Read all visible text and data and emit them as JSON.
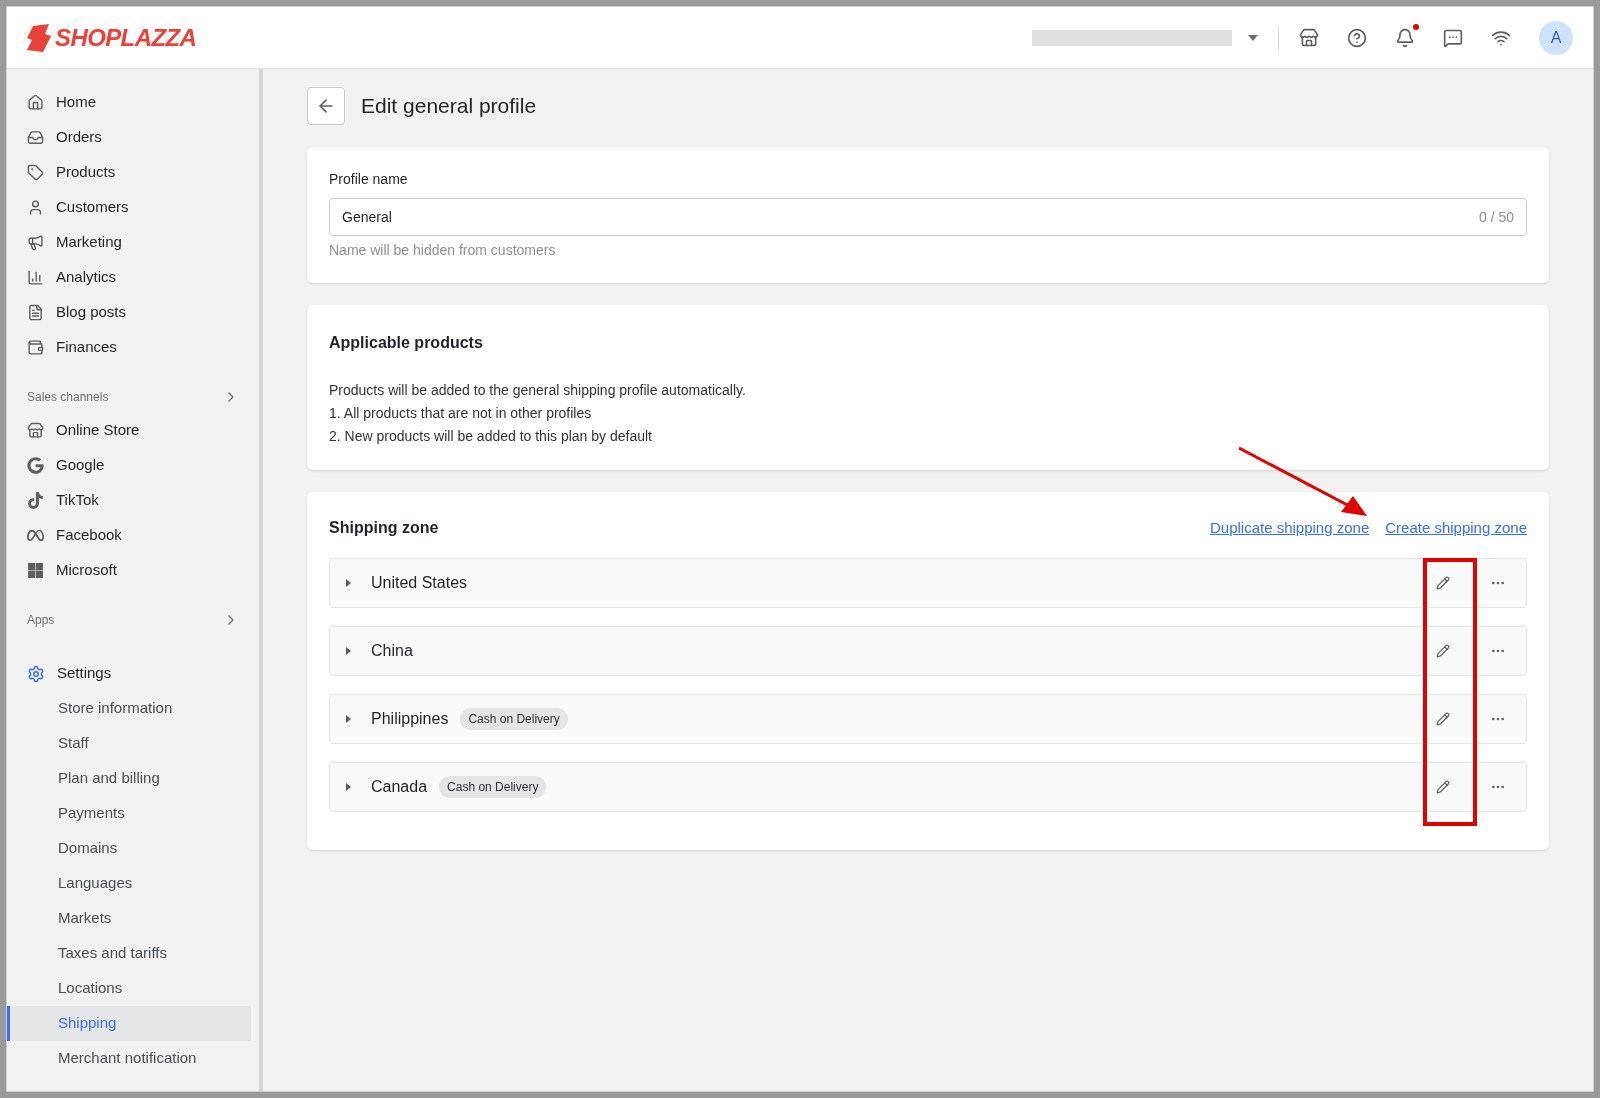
{
  "topbar": {
    "logo": "SHOPLAZZA",
    "avatar": "A",
    "notification_dot": true
  },
  "sidebar": {
    "items": [
      {
        "label": "Home"
      },
      {
        "label": "Orders"
      },
      {
        "label": "Products"
      },
      {
        "label": "Customers"
      },
      {
        "label": "Marketing"
      },
      {
        "label": "Analytics"
      },
      {
        "label": "Blog posts"
      },
      {
        "label": "Finances"
      }
    ],
    "sections": [
      {
        "title": "Sales channels",
        "items": [
          {
            "label": "Online Store"
          },
          {
            "label": "Google"
          },
          {
            "label": "TikTok"
          },
          {
            "label": "Facebook"
          },
          {
            "label": "Microsoft"
          }
        ]
      },
      {
        "title": "Apps"
      }
    ],
    "settings": {
      "label": "Settings",
      "children": [
        {
          "label": "Store information",
          "selected": false
        },
        {
          "label": "Staff",
          "selected": false
        },
        {
          "label": "Plan and billing",
          "selected": false
        },
        {
          "label": "Payments",
          "selected": false
        },
        {
          "label": "Domains",
          "selected": false
        },
        {
          "label": "Languages",
          "selected": false
        },
        {
          "label": "Markets",
          "selected": false
        },
        {
          "label": "Taxes and tariffs",
          "selected": false
        },
        {
          "label": "Locations",
          "selected": false
        },
        {
          "label": "Shipping",
          "selected": true
        },
        {
          "label": "Merchant notification",
          "selected": false
        }
      ]
    }
  },
  "page": {
    "title": "Edit general profile"
  },
  "profile": {
    "label": "Profile name",
    "value": "General",
    "counter": "0 / 50",
    "help": "Name will be hidden from customers"
  },
  "applicable": {
    "title": "Applicable products",
    "lines": [
      "Products will be added to the general shipping profile automatically.",
      "1. All products that are not in other profiles",
      "2. New products will be added to this plan by default"
    ]
  },
  "shipping": {
    "title": "Shipping zone",
    "links": [
      "Duplicate shipping zone",
      "Create shipping zone"
    ],
    "zones": [
      {
        "name": "United States"
      },
      {
        "name": "China"
      },
      {
        "name": "Philippines",
        "tag": "Cash on Delivery"
      },
      {
        "name": "Canada",
        "tag": "Cash on Delivery"
      }
    ]
  }
}
